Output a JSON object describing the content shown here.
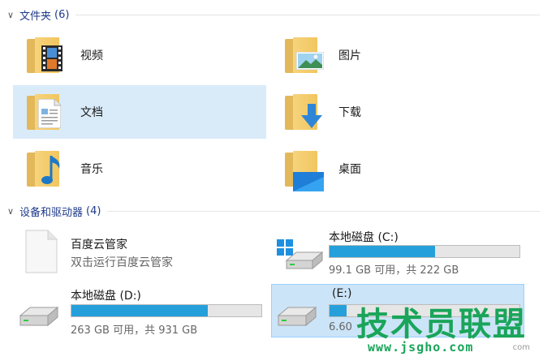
{
  "folders_group": {
    "title": "文件夹",
    "count": "(6)",
    "items": [
      {
        "label": "视频"
      },
      {
        "label": "图片"
      },
      {
        "label": "文档"
      },
      {
        "label": "下载"
      },
      {
        "label": "音乐"
      },
      {
        "label": "桌面"
      }
    ]
  },
  "devices_group": {
    "title": "设备和驱动器",
    "count": "(4)",
    "app": {
      "name": "百度云管家",
      "subtitle": "双击运行百度云管家"
    },
    "drives": [
      {
        "name": "本地磁盘 (C:)",
        "info": "99.1 GB 可用，共 222 GB",
        "used_fraction": 0.554
      },
      {
        "name": "本地磁盘 (D:)",
        "info": "263 GB 可用，共 931 GB",
        "used_fraction": 0.717
      },
      {
        "name": "(E:)",
        "info": "6.60",
        "used_fraction": 0.09
      }
    ]
  },
  "watermark": {
    "big": "技术员联盟",
    "small": "www.jsgho.com",
    "suffix": "com"
  },
  "colors": {
    "accent": "#26a0da",
    "selection": "#cce4f7",
    "watermark": "#1aa55a"
  }
}
